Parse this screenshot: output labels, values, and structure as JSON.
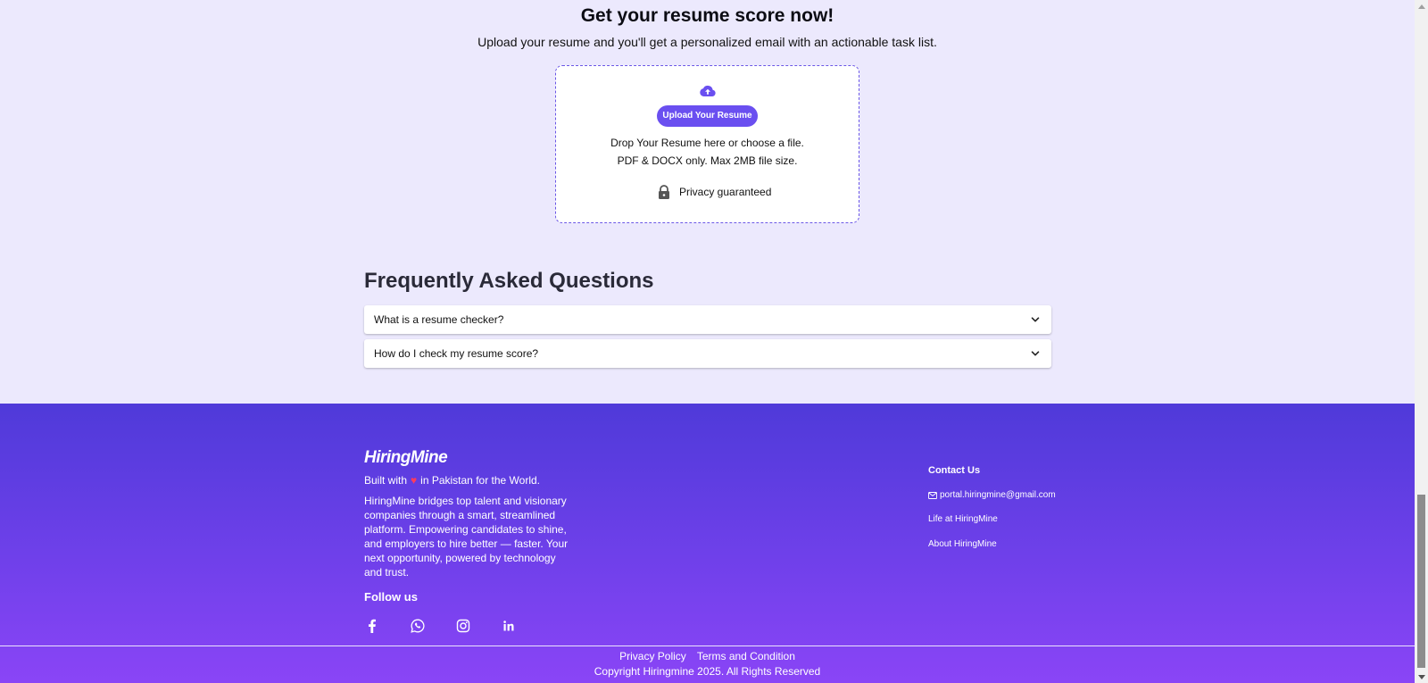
{
  "upload": {
    "title": "Get your resume score now!",
    "subtitle": "Upload your resume and you'll get a personalized email with an actionable task list.",
    "button_label": "Upload Your Resume",
    "drop_text": "Drop Your Resume here or choose a file.",
    "limits_text": "PDF & DOCX only. Max 2MB file size.",
    "privacy_text": "Privacy guaranteed",
    "accent_color": "#6a4ff0"
  },
  "faq": {
    "title": "Frequently Asked Questions",
    "items": [
      {
        "question": "What is a resume checker?"
      },
      {
        "question": "How do I check my resume score?"
      }
    ]
  },
  "footer": {
    "logo_text": "HiringMine",
    "built_prefix": "Built with",
    "built_suffix": "in Pakistan for the World.",
    "description": "HiringMine bridges top talent and visionary companies through a smart, streamlined platform. Empowering candidates to shine, and employers to hire better — faster. Your next opportunity, powered by technology and trust.",
    "follow_label": "Follow us",
    "socials": [
      "facebook-icon",
      "whatsapp-icon",
      "instagram-icon",
      "linkedin-icon"
    ],
    "contact": {
      "title": "Contact Us",
      "email": "portal.hiringmine@gmail.com",
      "life_link": "Life at HiringMine",
      "about_link": "About HiringMine"
    },
    "legal": {
      "privacy": "Privacy Policy",
      "terms": "Terms and Condition",
      "copyright": "Copyright Hiringmine 2025. All Rights Reserved"
    },
    "gradient_colors": [
      "#4f3ad9",
      "#8a45f6"
    ]
  }
}
